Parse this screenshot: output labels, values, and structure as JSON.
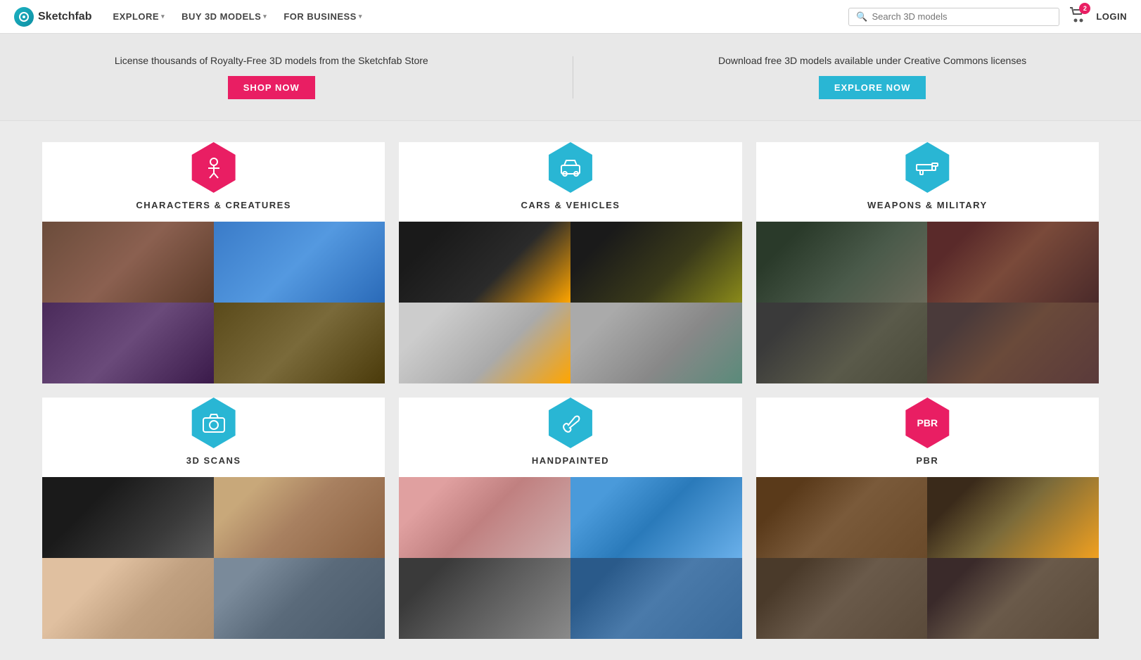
{
  "nav": {
    "logo_text": "Sketchfab",
    "links": [
      {
        "label": "EXPLORE",
        "has_caret": true
      },
      {
        "label": "BUY 3D MODELS",
        "has_caret": true
      },
      {
        "label": "FOR BUSINESS",
        "has_caret": true
      }
    ],
    "search_placeholder": "Search 3D models",
    "cart_badge": "2",
    "login_label": "LOGIN"
  },
  "banner": {
    "left_text": "License thousands of Royalty-Free 3D models from the Sketchfab Store",
    "left_btn": "SHOP NOW",
    "right_text": "Download free 3D models available under Creative Commons licenses",
    "right_btn": "EXPLORE NOW"
  },
  "categories": [
    {
      "id": "characters",
      "title": "CHARACTERS & CREATURES",
      "icon_type": "pink",
      "icon_label": "character-icon",
      "images": [
        "img-cc-1",
        "img-cc-2",
        "img-cc-3",
        "img-cc-4"
      ]
    },
    {
      "id": "cars",
      "title": "CARS & VEHICLES",
      "icon_type": "blue",
      "icon_label": "car-icon",
      "images": [
        "img-cv-1",
        "img-cv-2",
        "img-cv-3",
        "img-cv-4"
      ]
    },
    {
      "id": "weapons",
      "title": "WEAPONS & MILITARY",
      "icon_type": "blue",
      "icon_label": "weapons-icon",
      "images": [
        "img-wm-1",
        "img-wm-2",
        "img-wm-3",
        "img-wm-4"
      ]
    },
    {
      "id": "scans",
      "title": "3D SCANS",
      "icon_type": "blue",
      "icon_label": "camera-icon",
      "images": [
        "img-sc-1",
        "img-sc-2",
        "img-sc-3",
        "img-sc-4"
      ]
    },
    {
      "id": "handpainted",
      "title": "HANDPAINTED",
      "icon_type": "blue",
      "icon_label": "paint-icon",
      "images": [
        "img-hp-1",
        "img-hp-2",
        "img-hp-3",
        "img-hp-4"
      ]
    },
    {
      "id": "pbr",
      "title": "PBR",
      "icon_type": "pbr",
      "icon_label": "pbr-icon",
      "images": [
        "img-pbr-1",
        "img-pbr-2",
        "img-pbr-3",
        "img-pbr-4"
      ]
    }
  ]
}
